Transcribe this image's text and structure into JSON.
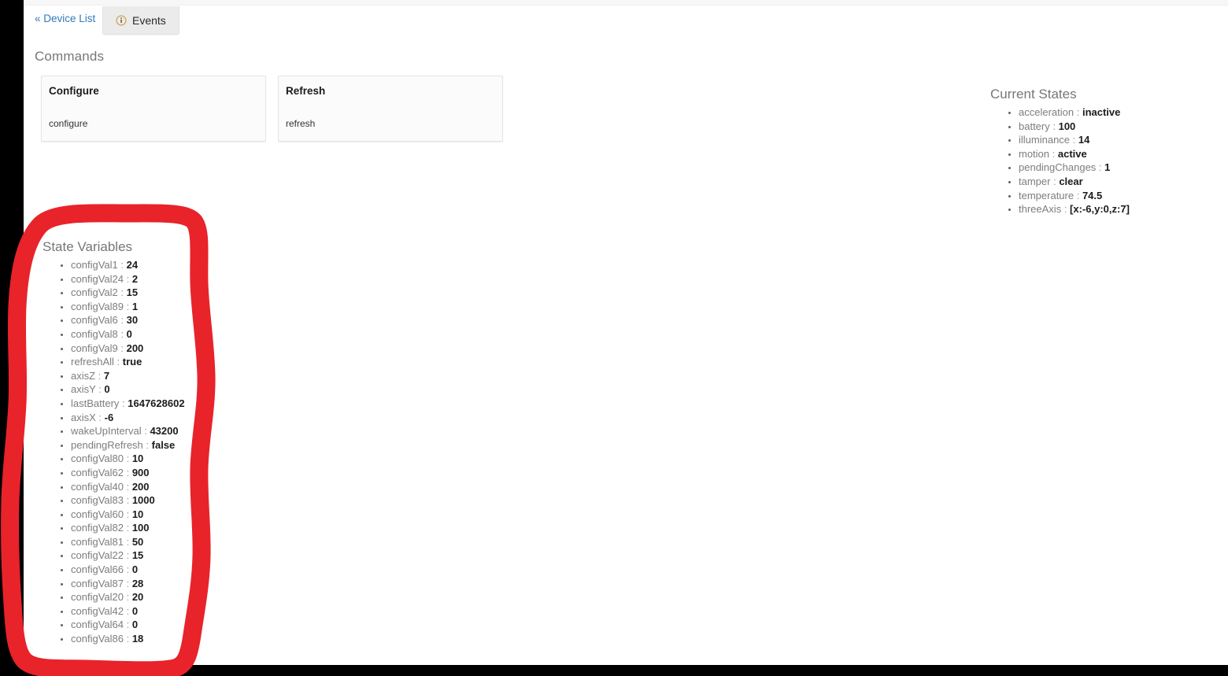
{
  "nav": {
    "device_list_label": "« Device List",
    "tab_events_label": "Events",
    "tab_events_icon": "info-circle-icon"
  },
  "commands": {
    "heading": "Commands",
    "cards": [
      {
        "title": "Configure",
        "command": "configure"
      },
      {
        "title": "Refresh",
        "command": "refresh"
      }
    ]
  },
  "current_states": {
    "heading": "Current States",
    "items": [
      {
        "key": "acceleration",
        "value": "inactive"
      },
      {
        "key": "battery",
        "value": "100"
      },
      {
        "key": "illuminance",
        "value": "14"
      },
      {
        "key": "motion",
        "value": "active"
      },
      {
        "key": "pendingChanges",
        "value": "1"
      },
      {
        "key": "tamper",
        "value": "clear"
      },
      {
        "key": "temperature",
        "value": "74.5"
      },
      {
        "key": "threeAxis",
        "value": "[x:-6,y:0,z:7]"
      }
    ]
  },
  "state_variables": {
    "heading": "State Variables",
    "items": [
      {
        "key": "configVal1",
        "value": "24"
      },
      {
        "key": "configVal24",
        "value": "2"
      },
      {
        "key": "configVal2",
        "value": "15"
      },
      {
        "key": "configVal89",
        "value": "1"
      },
      {
        "key": "configVal6",
        "value": "30"
      },
      {
        "key": "configVal8",
        "value": "0"
      },
      {
        "key": "configVal9",
        "value": "200"
      },
      {
        "key": "refreshAll",
        "value": "true"
      },
      {
        "key": "axisZ",
        "value": "7"
      },
      {
        "key": "axisY",
        "value": "0"
      },
      {
        "key": "lastBattery",
        "value": "1647628602"
      },
      {
        "key": "axisX",
        "value": "-6"
      },
      {
        "key": "wakeUpInterval",
        "value": "43200"
      },
      {
        "key": "pendingRefresh",
        "value": "false"
      },
      {
        "key": "configVal80",
        "value": "10"
      },
      {
        "key": "configVal62",
        "value": "900"
      },
      {
        "key": "configVal40",
        "value": "200"
      },
      {
        "key": "configVal83",
        "value": "1000"
      },
      {
        "key": "configVal60",
        "value": "10"
      },
      {
        "key": "configVal82",
        "value": "100"
      },
      {
        "key": "configVal81",
        "value": "50"
      },
      {
        "key": "configVal22",
        "value": "15"
      },
      {
        "key": "configVal66",
        "value": "0"
      },
      {
        "key": "configVal87",
        "value": "28"
      },
      {
        "key": "configVal20",
        "value": "20"
      },
      {
        "key": "configVal42",
        "value": "0"
      },
      {
        "key": "configVal64",
        "value": "0"
      },
      {
        "key": "configVal86",
        "value": "18"
      }
    ]
  },
  "annotation": {
    "shape": "hand-drawn-rectangle",
    "color": "#E8232A",
    "target": "state-variables-panel"
  },
  "colors": {
    "link": "#337ab7",
    "heading": "#777777",
    "value": "#1b1b1b",
    "info_icon": "#E8A33D",
    "annotation_red": "#E8232A"
  }
}
